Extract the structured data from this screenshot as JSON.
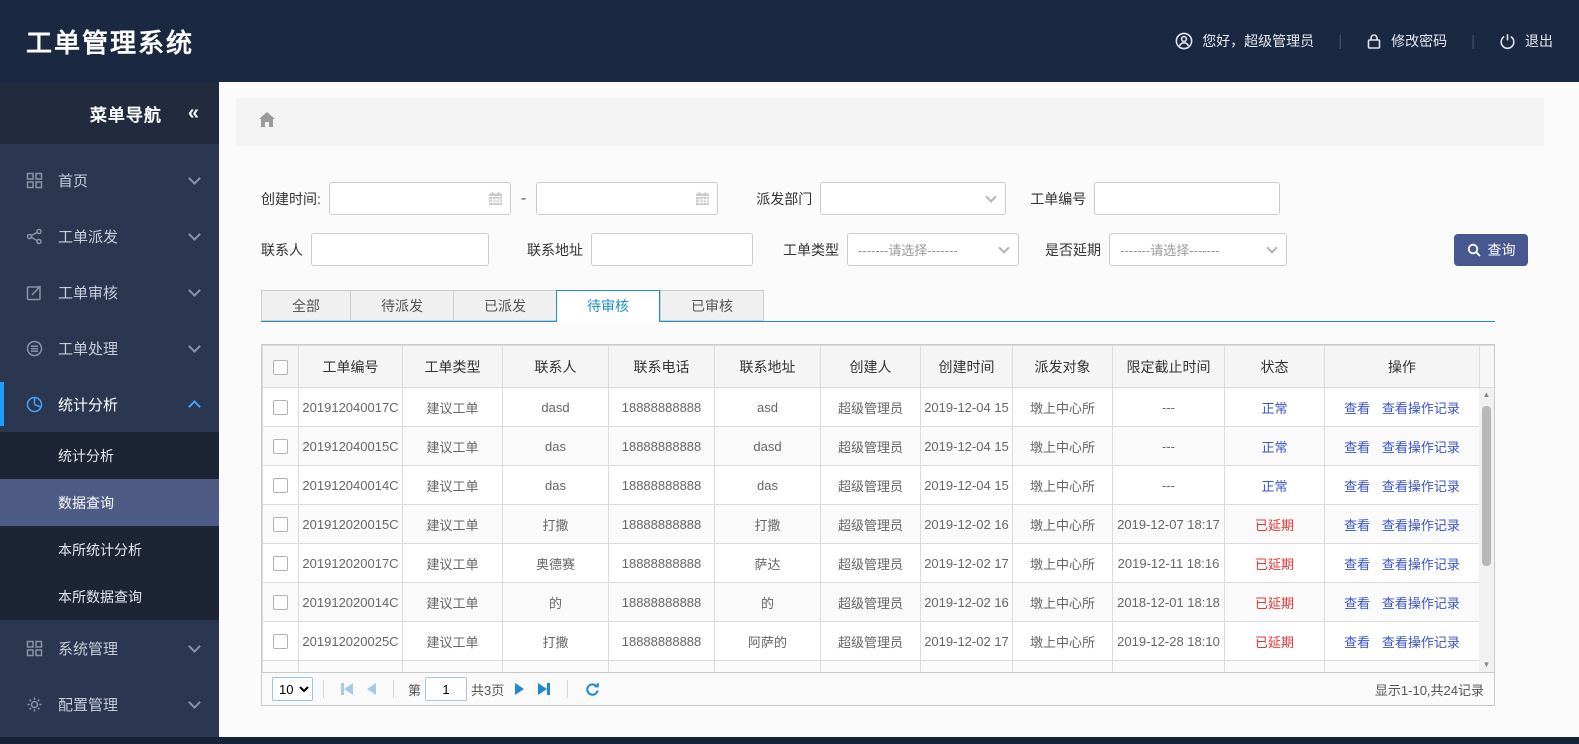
{
  "app": {
    "title": "工单管理系统"
  },
  "header": {
    "greeting": "您好，超级管理员",
    "change_password": "修改密码",
    "logout": "退出",
    "separator": "|"
  },
  "sidebar": {
    "nav_title": "菜单导航",
    "collapse_glyph": "«",
    "items": [
      {
        "label": "首页",
        "icon": "grid-icon"
      },
      {
        "label": "工单派发",
        "icon": "share-icon"
      },
      {
        "label": "工单审核",
        "icon": "edit-icon"
      },
      {
        "label": "工单处理",
        "icon": "process-icon"
      },
      {
        "label": "统计分析",
        "icon": "pie-chart-icon",
        "active": true,
        "expanded": true
      },
      {
        "label": "系统管理",
        "icon": "modules-icon"
      },
      {
        "label": "配置管理",
        "icon": "gear-icon"
      }
    ],
    "submenu": [
      {
        "label": "统计分析"
      },
      {
        "label": "数据查询",
        "selected": true
      },
      {
        "label": "本所统计分析"
      },
      {
        "label": "本所数据查询"
      }
    ]
  },
  "filters": {
    "create_time_label": "创建时间:",
    "range_separator": "-",
    "dispatch_dept_label": "派发部门",
    "order_no_label": "工单编号",
    "contact_label": "联系人",
    "address_label": "联系地址",
    "order_type_label": "工单类型",
    "delay_label": "是否延期",
    "select_placeholder": "-------请选择-------",
    "search_button": "查询"
  },
  "tabs": [
    {
      "label": "全部"
    },
    {
      "label": "待派发"
    },
    {
      "label": "已派发"
    },
    {
      "label": "待审核",
      "active": true
    },
    {
      "label": "已审核"
    }
  ],
  "table": {
    "columns": [
      "工单编号",
      "工单类型",
      "联系人",
      "联系电话",
      "联系地址",
      "创建人",
      "创建时间",
      "派发对象",
      "限定截止时间",
      "状态",
      "操作"
    ],
    "action_view": "查看",
    "action_log": "查看操作记录",
    "rows": [
      {
        "order_no": "201912040017C",
        "type": "建议工单",
        "contact": "dasd",
        "phone": "18888888888",
        "address": "asd",
        "creator": "超级管理员",
        "created": "2019-12-04 15",
        "target": "墩上中心所",
        "deadline": "---",
        "status": "正常",
        "status_color": "blue"
      },
      {
        "order_no": "201912040015C",
        "type": "建议工单",
        "contact": "das",
        "phone": "18888888888",
        "address": "dasd",
        "creator": "超级管理员",
        "created": "2019-12-04 15",
        "target": "墩上中心所",
        "deadline": "---",
        "status": "正常",
        "status_color": "blue"
      },
      {
        "order_no": "201912040014C",
        "type": "建议工单",
        "contact": "das",
        "phone": "18888888888",
        "address": "das",
        "creator": "超级管理员",
        "created": "2019-12-04 15",
        "target": "墩上中心所",
        "deadline": "---",
        "status": "正常",
        "status_color": "blue"
      },
      {
        "order_no": "201912020015C",
        "type": "建议工单",
        "contact": "打撒",
        "phone": "18888888888",
        "address": "打撒",
        "creator": "超级管理员",
        "created": "2019-12-02 16",
        "target": "墩上中心所",
        "deadline": "2019-12-07 18:17",
        "status": "已延期",
        "status_color": "red"
      },
      {
        "order_no": "201912020017C",
        "type": "建议工单",
        "contact": "奥德赛",
        "phone": "18888888888",
        "address": "萨达",
        "creator": "超级管理员",
        "created": "2019-12-02 17",
        "target": "墩上中心所",
        "deadline": "2019-12-11 18:16",
        "status": "已延期",
        "status_color": "red"
      },
      {
        "order_no": "201912020014C",
        "type": "建议工单",
        "contact": "的",
        "phone": "18888888888",
        "address": "的",
        "creator": "超级管理员",
        "created": "2019-12-02 16",
        "target": "墩上中心所",
        "deadline": "2018-12-01 18:18",
        "status": "已延期",
        "status_color": "red"
      },
      {
        "order_no": "201912020025C",
        "type": "建议工单",
        "contact": "打撒",
        "phone": "18888888888",
        "address": "阿萨的",
        "creator": "超级管理员",
        "created": "2019-12-02 17",
        "target": "墩上中心所",
        "deadline": "2019-12-28 18:10",
        "status": "已延期",
        "status_color": "red"
      }
    ],
    "has_partial_row": true
  },
  "pagination": {
    "page_size": "10",
    "page_prefix": "第",
    "current_page": "1",
    "total_pages_text": "共3页",
    "summary": "显示1-10,共24记录"
  },
  "colors": {
    "header_bg": "#1b2842",
    "sidebar_bg": "#2b3750",
    "accent_blue": "#1d8fd1",
    "button_bg": "#46588f",
    "status_normal": "#3b55c9",
    "status_delayed": "#e03636",
    "link": "#3b55c9"
  }
}
